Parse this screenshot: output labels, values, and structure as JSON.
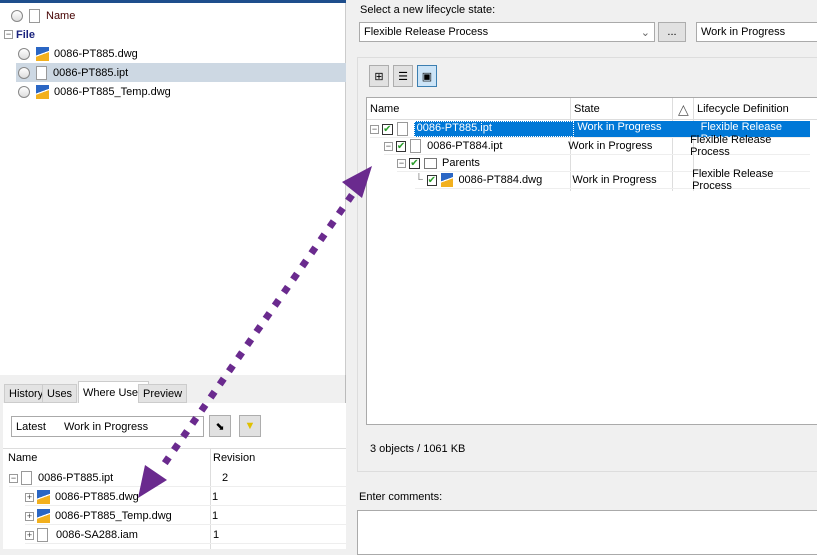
{
  "file_list": {
    "header": "Name",
    "group": "File",
    "items": [
      {
        "name": "0086-PT885.dwg",
        "icon": "dwg-icon"
      },
      {
        "name": "0086-PT885.ipt",
        "icon": "document-icon",
        "selected": true
      },
      {
        "name": "0086-PT885_Temp.dwg",
        "icon": "dwg-icon"
      }
    ]
  },
  "lower_tabs": [
    "History",
    "Uses",
    "Where Used",
    "Preview"
  ],
  "where_used": {
    "filter_version": "Latest",
    "filter_state": "Work in Progress",
    "columns": [
      "Name",
      "Revision"
    ],
    "rows": [
      {
        "name": "0086-PT885.ipt",
        "revision": "2"
      },
      {
        "name": "0086-PT885.dwg",
        "revision": "1"
      },
      {
        "name": "0086-PT885_Temp.dwg",
        "revision": "1"
      },
      {
        "name": "0086-SA288.iam",
        "revision": "1"
      }
    ]
  },
  "lifecycle": {
    "prompt": "Select a new lifecycle state:",
    "definition": "Flexible Release Process",
    "browse_label": "...",
    "state": "Work in Progress",
    "columns": [
      "Name",
      "State",
      "△",
      "Lifecycle Definition"
    ],
    "rows": [
      {
        "name": "0086-PT885.ipt",
        "state": "Work in Progress",
        "definition": "Flexible Release Process"
      },
      {
        "name": "0086-PT884.ipt",
        "state": "Work in Progress",
        "definition": "Flexible Release Process"
      },
      {
        "name": "Parents",
        "state": "",
        "definition": ""
      },
      {
        "name": "0086-PT884.dwg",
        "state": "Work in Progress",
        "definition": "Flexible Release Process"
      }
    ],
    "summary": "3 objects / 1061 KB",
    "comments_label": "Enter comments:"
  },
  "colors": {
    "selection": "#0078d7",
    "annotation_arrow": "#6a2a8e"
  }
}
